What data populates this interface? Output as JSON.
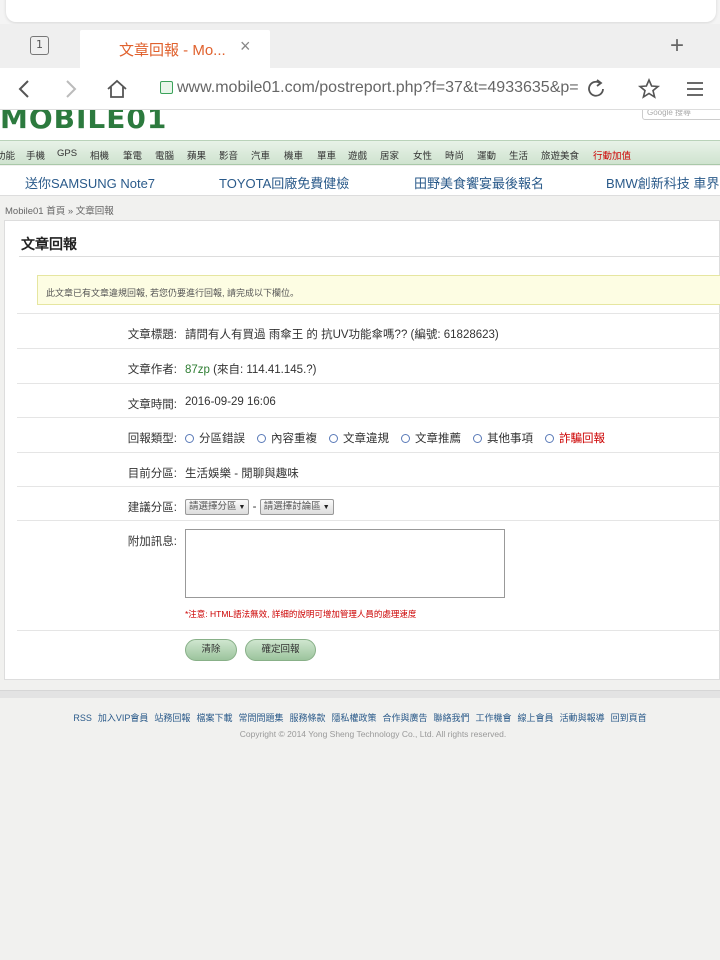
{
  "browser": {
    "tab_count": "1",
    "tab_title": "文章回報 - Mo...",
    "tab_close": "×",
    "new_tab": "+",
    "url": "www.mobile01.com/postreport.php?f=37&t=4933635&p="
  },
  "site": {
    "logo": "MOBILE01",
    "search_placeholder": "Google 搜尋"
  },
  "categories": [
    {
      "label": "功能"
    },
    {
      "label": "手機"
    },
    {
      "label": "GPS"
    },
    {
      "label": "相機"
    },
    {
      "label": "筆電"
    },
    {
      "label": "電腦"
    },
    {
      "label": "蘋果"
    },
    {
      "label": "影音"
    },
    {
      "label": "汽車"
    },
    {
      "label": "機車"
    },
    {
      "label": "單車"
    },
    {
      "label": "遊戲"
    },
    {
      "label": "居家"
    },
    {
      "label": "女性"
    },
    {
      "label": "時尚"
    },
    {
      "label": "運動"
    },
    {
      "label": "生活"
    },
    {
      "label": "旅遊美食"
    },
    {
      "label": "行動加值",
      "hot": true
    }
  ],
  "promos": [
    "送你SAMSUNG Note7",
    "TOYOTA回廠免費健檢",
    "田野美食饗宴最後報名",
    "BMW創新科技 車界"
  ],
  "breadcrumb": "Mobile01 首頁 » 文章回報",
  "panel": {
    "title": "文章回報",
    "notice": "此文章已有文章違規回報, 若您仍要進行回報, 請完成以下欄位。"
  },
  "form": {
    "article_title_label": "文章標題:",
    "article_title": "請問有人有買過 雨傘王 的 抗UV功能傘嗎?? (編號: 61828623)",
    "author_label": "文章作者:",
    "author_name": "87zp",
    "author_from": "(來自: 114.41.145.?)",
    "time_label": "文章時間:",
    "time": "2016-09-29 16:06",
    "type_label": "回報類型:",
    "types": [
      {
        "label": "分區錯誤"
      },
      {
        "label": "內容重複"
      },
      {
        "label": "文章違規"
      },
      {
        "label": "文章推薦"
      },
      {
        "label": "其他事項"
      },
      {
        "label": "詐騙回報",
        "highlight": true
      }
    ],
    "current_label": "目前分區:",
    "current": "生活娛樂 - 閒聊與趣味",
    "suggest_label": "建議分區:",
    "select_zone": "請選擇分區",
    "select_board": "請選擇討論區",
    "select_sep": "-",
    "message_label": "附加訊息:",
    "hint": "*注意: HTML語法無效, 詳細的說明可增加管理人員的處理速度",
    "clear": "清除",
    "submit": "確定回報"
  },
  "footer": {
    "links": [
      "RSS",
      "加入VIP會員",
      "站務回報",
      "檔案下載",
      "常問問題集",
      "服務條款",
      "隱私權政策",
      "合作與廣告",
      "聯絡我們",
      "工作機會",
      "線上會員",
      "活動與報導",
      "回到頁首"
    ],
    "copyright": "Copyright © 2014 Yong Sheng Technology Co., Ltd. All rights reserved."
  },
  "colors": {
    "accent": "#e0612d",
    "brand_green": "#2c7a3e",
    "link": "#2a5a8a",
    "alert": "#cc0000"
  }
}
